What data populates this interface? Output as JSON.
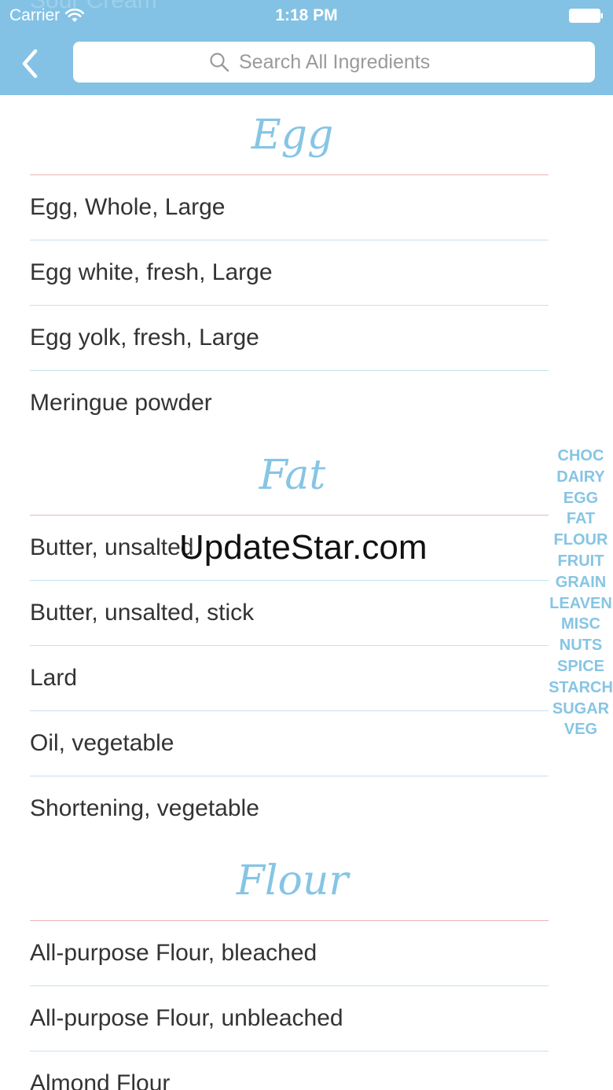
{
  "status_bar": {
    "carrier": "Carrier",
    "time": "1:18 PM"
  },
  "header": {
    "ghost_text": "Sour Cream",
    "search_placeholder": "Search All Ingredients"
  },
  "sections": [
    {
      "title": "Egg",
      "items": [
        "Egg, Whole, Large",
        "Egg white, fresh, Large",
        "Egg yolk, fresh, Large",
        "Meringue powder"
      ]
    },
    {
      "title": "Fat",
      "items": [
        "Butter, unsalted",
        "Butter, unsalted, stick",
        "Lard",
        "Oil, vegetable",
        "Shortening, vegetable"
      ]
    },
    {
      "title": "Flour",
      "items": [
        "All-purpose Flour, bleached",
        "All-purpose Flour, unbleached",
        "Almond Flour"
      ]
    }
  ],
  "index": [
    "CHOC",
    "DAIRY",
    "EGG",
    "FAT",
    "FLOUR",
    "FRUIT",
    "GRAIN",
    "LEAVEN",
    "MISC",
    "NUTS",
    "SPICE",
    "STARCH",
    "SUGAR",
    "VEG"
  ],
  "watermark": "UpdateStar.com",
  "colors": {
    "header": "#83c2e4",
    "accent": "#86c5e4",
    "section_divider": "#efb4b4",
    "row_divider": "#c6e1f0"
  }
}
